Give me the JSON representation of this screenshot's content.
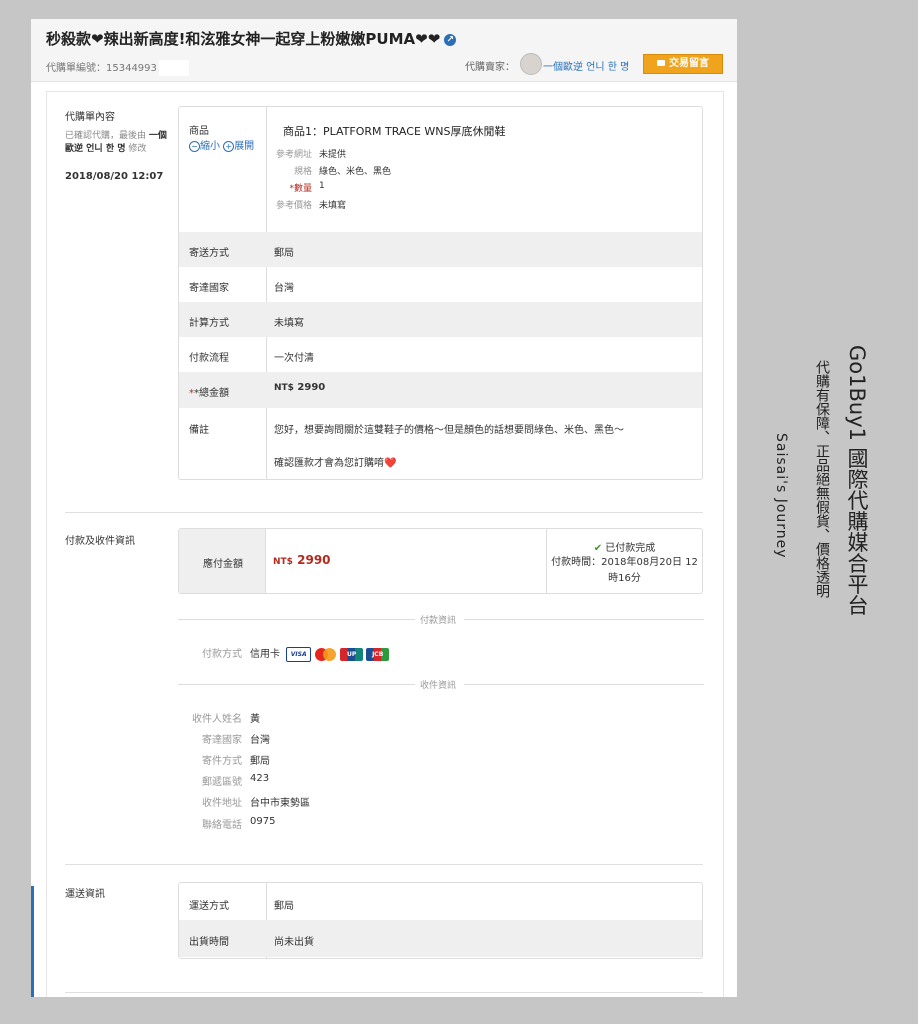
{
  "header": {
    "title": "秒殺款❤辣出新高度!和泫雅女神一起穿上粉嫩嫩PUMA❤❤",
    "order_no_label": "代購單編號：",
    "order_no": "15344993",
    "seller_label": "代購賣家：",
    "seller_name": "一個歐逆 언니 한 명",
    "message_button": "交易留言"
  },
  "order": {
    "section_title": "代購單內容",
    "note": "已確認代購，最後由",
    "note_user": "一個歐逆 언니 한 명",
    "note_action": "修改",
    "date": "2018/08/20 12:07",
    "item_label": "商品",
    "collapse": "縮小",
    "expand": "展開",
    "item_title": "商品1：PLATFORM TRACE WNS厚底休閒鞋",
    "specs": [
      {
        "k": "參考網址",
        "v": "未提供"
      },
      {
        "k": "規格",
        "v": "綠色、米色、黑色"
      },
      {
        "k": "*數量",
        "v": "1"
      },
      {
        "k": "參考價格",
        "v": "未填寫"
      }
    ],
    "rows": [
      {
        "label": "寄送方式",
        "value": "郵局"
      },
      {
        "label": "寄達國家",
        "value": "台灣"
      },
      {
        "label": "計算方式",
        "value": "未填寫"
      },
      {
        "label": "付款流程",
        "value": "一次付清"
      }
    ],
    "total_label": "*總金額",
    "total_currency": "NT$",
    "total_amount": "2990",
    "remark_label": "備註",
    "remark_line1": "您好，想要詢問關於這雙鞋子的價格～但是顏色的話想要問綠色、米色、黑色～",
    "remark_line2": "確認匯款才會為您訂購唷❤️"
  },
  "payment": {
    "section_title": "付款及收件資訊",
    "due_label": "應付金額",
    "due_currency": "NT$",
    "due_amount": "2990",
    "status": "已付款完成",
    "paid_time_line1": "付款時間：2018年08月20日 12",
    "paid_time_line2": "時16分",
    "pay_info_title": "付款資訊",
    "method_label": "付款方式",
    "method_value": "信用卡",
    "cards": [
      "VISA",
      "MC",
      "UnionPay",
      "JCB"
    ],
    "recv_info_title": "收件資訊",
    "recipient": [
      {
        "k": "收件人姓名",
        "v": "黃"
      },
      {
        "k": "寄達國家",
        "v": "台灣"
      },
      {
        "k": "寄件方式",
        "v": "郵局"
      },
      {
        "k": "郵遞區號",
        "v": "423"
      },
      {
        "k": "收件地址",
        "v": "台中市東勢區"
      },
      {
        "k": "聯絡電話",
        "v": "0975"
      }
    ]
  },
  "shipping": {
    "section_title": "運送資訊",
    "rows": [
      {
        "label": "運送方式",
        "value": "郵局"
      },
      {
        "label": "出貨時間",
        "value": "尚未出貨"
      }
    ]
  },
  "side": {
    "line1": "Go1Buy1 國際代購媒合平台",
    "line2": "代購有保障、正品絕無假貨、價格透明",
    "line3": "Saisai's Journey"
  },
  "colors": {
    "accent": "#2a6fb8",
    "price": "#b52a1e",
    "button": "#f0a31c"
  }
}
